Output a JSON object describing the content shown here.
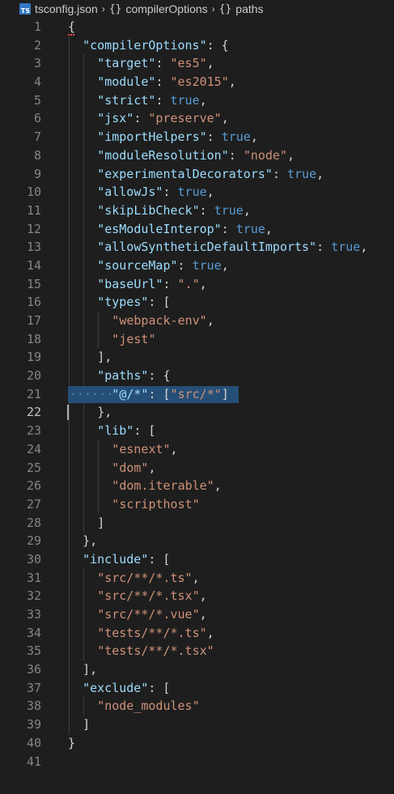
{
  "breadcrumb": {
    "file_icon": "TS",
    "file_name": "tsconfig.json",
    "crumb1": "compilerOptions",
    "crumb2": "paths",
    "separator": "›",
    "object_icon": "{}"
  },
  "editor": {
    "active_line": 22,
    "selected_line": 21,
    "lines": [
      {
        "n": "1",
        "indent": 0,
        "tokens": [
          {
            "t": "p",
            "v": "{"
          }
        ]
      },
      {
        "n": "2",
        "indent": 1,
        "tokens": [
          {
            "t": "k",
            "v": "\"compilerOptions\""
          },
          {
            "t": "p",
            "v": ": {"
          }
        ]
      },
      {
        "n": "3",
        "indent": 2,
        "tokens": [
          {
            "t": "k",
            "v": "\"target\""
          },
          {
            "t": "p",
            "v": ": "
          },
          {
            "t": "s",
            "v": "\"es5\""
          },
          {
            "t": "p",
            "v": ","
          }
        ]
      },
      {
        "n": "4",
        "indent": 2,
        "tokens": [
          {
            "t": "k",
            "v": "\"module\""
          },
          {
            "t": "p",
            "v": ": "
          },
          {
            "t": "s",
            "v": "\"es2015\""
          },
          {
            "t": "p",
            "v": ","
          }
        ]
      },
      {
        "n": "5",
        "indent": 2,
        "tokens": [
          {
            "t": "k",
            "v": "\"strict\""
          },
          {
            "t": "p",
            "v": ": "
          },
          {
            "t": "b",
            "v": "true"
          },
          {
            "t": "p",
            "v": ","
          }
        ]
      },
      {
        "n": "6",
        "indent": 2,
        "tokens": [
          {
            "t": "k",
            "v": "\"jsx\""
          },
          {
            "t": "p",
            "v": ": "
          },
          {
            "t": "s",
            "v": "\"preserve\""
          },
          {
            "t": "p",
            "v": ","
          }
        ]
      },
      {
        "n": "7",
        "indent": 2,
        "tokens": [
          {
            "t": "k",
            "v": "\"importHelpers\""
          },
          {
            "t": "p",
            "v": ": "
          },
          {
            "t": "b",
            "v": "true"
          },
          {
            "t": "p",
            "v": ","
          }
        ]
      },
      {
        "n": "8",
        "indent": 2,
        "tokens": [
          {
            "t": "k",
            "v": "\"moduleResolution\""
          },
          {
            "t": "p",
            "v": ": "
          },
          {
            "t": "s",
            "v": "\"node\""
          },
          {
            "t": "p",
            "v": ","
          }
        ]
      },
      {
        "n": "9",
        "indent": 2,
        "tokens": [
          {
            "t": "k",
            "v": "\"experimentalDecorators\""
          },
          {
            "t": "p",
            "v": ": "
          },
          {
            "t": "b",
            "v": "true"
          },
          {
            "t": "p",
            "v": ","
          }
        ]
      },
      {
        "n": "10",
        "indent": 2,
        "tokens": [
          {
            "t": "k",
            "v": "\"allowJs\""
          },
          {
            "t": "p",
            "v": ": "
          },
          {
            "t": "b",
            "v": "true"
          },
          {
            "t": "p",
            "v": ","
          }
        ]
      },
      {
        "n": "11",
        "indent": 2,
        "tokens": [
          {
            "t": "k",
            "v": "\"skipLibCheck\""
          },
          {
            "t": "p",
            "v": ": "
          },
          {
            "t": "b",
            "v": "true"
          },
          {
            "t": "p",
            "v": ","
          }
        ]
      },
      {
        "n": "12",
        "indent": 2,
        "tokens": [
          {
            "t": "k",
            "v": "\"esModuleInterop\""
          },
          {
            "t": "p",
            "v": ": "
          },
          {
            "t": "b",
            "v": "true"
          },
          {
            "t": "p",
            "v": ","
          }
        ]
      },
      {
        "n": "13",
        "indent": 2,
        "tokens": [
          {
            "t": "k",
            "v": "\"allowSyntheticDefaultImports\""
          },
          {
            "t": "p",
            "v": ": "
          },
          {
            "t": "b",
            "v": "true"
          },
          {
            "t": "p",
            "v": ","
          }
        ]
      },
      {
        "n": "14",
        "indent": 2,
        "tokens": [
          {
            "t": "k",
            "v": "\"sourceMap\""
          },
          {
            "t": "p",
            "v": ": "
          },
          {
            "t": "b",
            "v": "true"
          },
          {
            "t": "p",
            "v": ","
          }
        ]
      },
      {
        "n": "15",
        "indent": 2,
        "tokens": [
          {
            "t": "k",
            "v": "\"baseUrl\""
          },
          {
            "t": "p",
            "v": ": "
          },
          {
            "t": "s",
            "v": "\".\""
          },
          {
            "t": "p",
            "v": ","
          }
        ]
      },
      {
        "n": "16",
        "indent": 2,
        "tokens": [
          {
            "t": "k",
            "v": "\"types\""
          },
          {
            "t": "p",
            "v": ": ["
          }
        ]
      },
      {
        "n": "17",
        "indent": 3,
        "tokens": [
          {
            "t": "s",
            "v": "\"webpack-env\""
          },
          {
            "t": "p",
            "v": ","
          }
        ]
      },
      {
        "n": "18",
        "indent": 3,
        "tokens": [
          {
            "t": "s",
            "v": "\"jest\""
          }
        ]
      },
      {
        "n": "19",
        "indent": 2,
        "tokens": [
          {
            "t": "p",
            "v": "],"
          }
        ]
      },
      {
        "n": "20",
        "indent": 2,
        "tokens": [
          {
            "t": "k",
            "v": "\"paths\""
          },
          {
            "t": "p",
            "v": ": {"
          }
        ]
      },
      {
        "n": "21",
        "indent": 3,
        "tokens": [
          {
            "t": "k",
            "v": "\"@/*\""
          },
          {
            "t": "p",
            "v": ": ["
          },
          {
            "t": "s",
            "v": "\"src/*\""
          },
          {
            "t": "p",
            "v": "]"
          }
        ]
      },
      {
        "n": "22",
        "indent": 2,
        "tokens": [
          {
            "t": "p",
            "v": "},"
          }
        ]
      },
      {
        "n": "23",
        "indent": 2,
        "tokens": [
          {
            "t": "k",
            "v": "\"lib\""
          },
          {
            "t": "p",
            "v": ": ["
          }
        ]
      },
      {
        "n": "24",
        "indent": 3,
        "tokens": [
          {
            "t": "s",
            "v": "\"esnext\""
          },
          {
            "t": "p",
            "v": ","
          }
        ]
      },
      {
        "n": "25",
        "indent": 3,
        "tokens": [
          {
            "t": "s",
            "v": "\"dom\""
          },
          {
            "t": "p",
            "v": ","
          }
        ]
      },
      {
        "n": "26",
        "indent": 3,
        "tokens": [
          {
            "t": "s",
            "v": "\"dom.iterable\""
          },
          {
            "t": "p",
            "v": ","
          }
        ]
      },
      {
        "n": "27",
        "indent": 3,
        "tokens": [
          {
            "t": "s",
            "v": "\"scripthost\""
          }
        ]
      },
      {
        "n": "28",
        "indent": 2,
        "tokens": [
          {
            "t": "p",
            "v": "]"
          }
        ]
      },
      {
        "n": "29",
        "indent": 1,
        "tokens": [
          {
            "t": "p",
            "v": "},"
          }
        ]
      },
      {
        "n": "30",
        "indent": 1,
        "tokens": [
          {
            "t": "k",
            "v": "\"include\""
          },
          {
            "t": "p",
            "v": ": ["
          }
        ]
      },
      {
        "n": "31",
        "indent": 2,
        "tokens": [
          {
            "t": "s",
            "v": "\"src/**/*.ts\""
          },
          {
            "t": "p",
            "v": ","
          }
        ]
      },
      {
        "n": "32",
        "indent": 2,
        "tokens": [
          {
            "t": "s",
            "v": "\"src/**/*.tsx\""
          },
          {
            "t": "p",
            "v": ","
          }
        ]
      },
      {
        "n": "33",
        "indent": 2,
        "tokens": [
          {
            "t": "s",
            "v": "\"src/**/*.vue\""
          },
          {
            "t": "p",
            "v": ","
          }
        ]
      },
      {
        "n": "34",
        "indent": 2,
        "tokens": [
          {
            "t": "s",
            "v": "\"tests/**/*.ts\""
          },
          {
            "t": "p",
            "v": ","
          }
        ]
      },
      {
        "n": "35",
        "indent": 2,
        "tokens": [
          {
            "t": "s",
            "v": "\"tests/**/*.tsx\""
          }
        ]
      },
      {
        "n": "36",
        "indent": 1,
        "tokens": [
          {
            "t": "p",
            "v": "],"
          }
        ]
      },
      {
        "n": "37",
        "indent": 1,
        "tokens": [
          {
            "t": "k",
            "v": "\"exclude\""
          },
          {
            "t": "p",
            "v": ": ["
          }
        ]
      },
      {
        "n": "38",
        "indent": 2,
        "tokens": [
          {
            "t": "s",
            "v": "\"node_modules\""
          }
        ]
      },
      {
        "n": "39",
        "indent": 1,
        "tokens": [
          {
            "t": "p",
            "v": "]"
          }
        ]
      },
      {
        "n": "40",
        "indent": 0,
        "tokens": [
          {
            "t": "p",
            "v": "}"
          }
        ]
      },
      {
        "n": "41",
        "indent": 0,
        "tokens": []
      }
    ]
  },
  "colors": {
    "background": "#1e1e1e",
    "key": "#9cdcfe",
    "string": "#ce9178",
    "boolean": "#569cd6",
    "punctuation": "#d4d4d4",
    "line_number": "#858585",
    "selection": "#264f78"
  }
}
